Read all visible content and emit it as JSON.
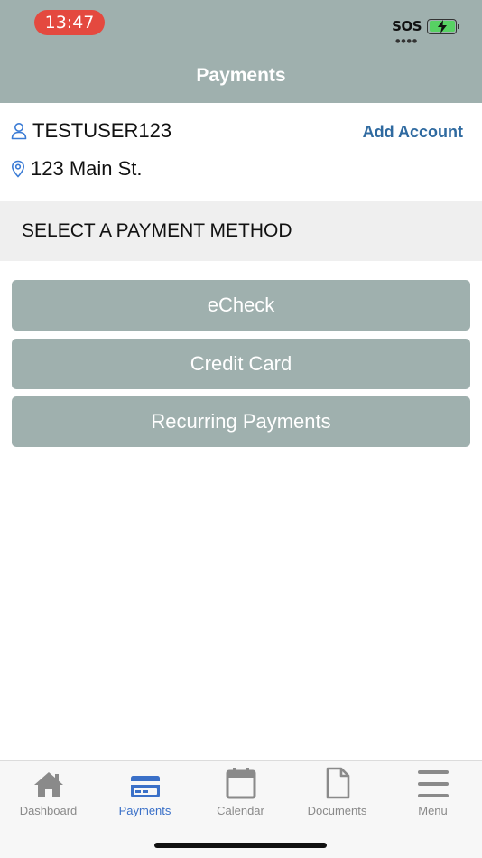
{
  "status_bar": {
    "time": "13:47",
    "carrier": "SOS"
  },
  "header": {
    "title": "Payments"
  },
  "account": {
    "username": "TESTUSER123",
    "address": "123 Main St.",
    "add_account_label": "Add Account"
  },
  "section": {
    "title": "SELECT A PAYMENT METHOD"
  },
  "payment_methods": [
    {
      "label": "eCheck"
    },
    {
      "label": "Credit Card"
    },
    {
      "label": "Recurring Payments"
    }
  ],
  "tabbar": {
    "items": [
      {
        "label": "Dashboard",
        "icon": "home-icon"
      },
      {
        "label": "Payments",
        "icon": "credit-card-icon",
        "active": true
      },
      {
        "label": "Calendar",
        "icon": "calendar-icon"
      },
      {
        "label": "Documents",
        "icon": "document-icon"
      },
      {
        "label": "Menu",
        "icon": "menu-icon"
      }
    ]
  },
  "colors": {
    "header_bg": "#9fb0ae",
    "button_bg": "#9fb0ae",
    "accent": "#2f6aa0",
    "active_tab": "#3a70c8",
    "time_pill": "#e4493f",
    "section_bg": "#efefef"
  }
}
